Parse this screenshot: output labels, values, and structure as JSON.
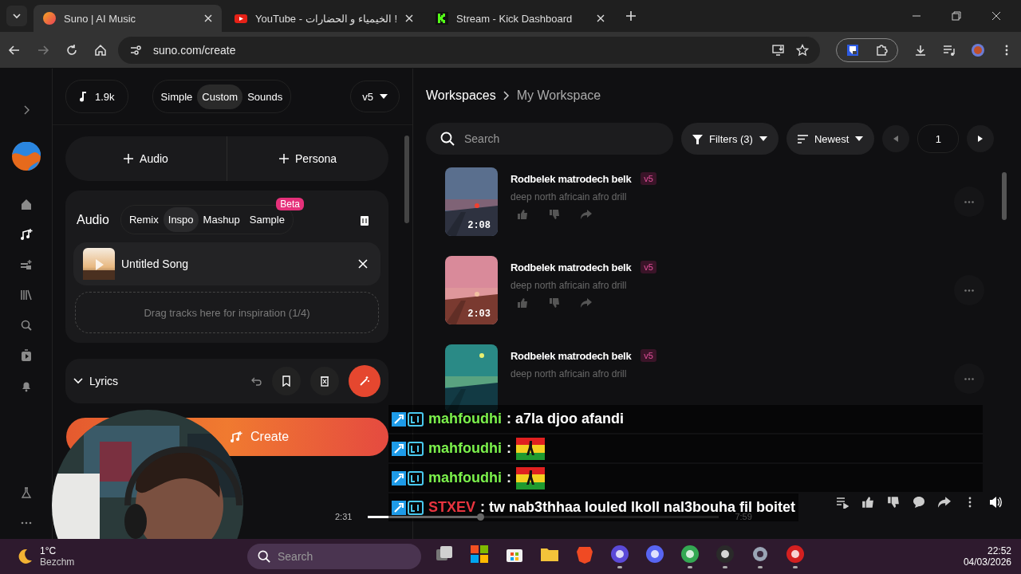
{
  "browser": {
    "tabs": [
      {
        "title": "Suno | AI Music",
        "kind": "suno",
        "selected": true
      },
      {
        "title": "YouTube - الخيمياء و الحضارات !",
        "kind": "youtube",
        "selected": false
      },
      {
        "title": "Stream - Kick Dashboard",
        "kind": "kick",
        "selected": false
      }
    ],
    "address": "suno.com/create"
  },
  "sidebar": {
    "items": [
      {
        "kind": "home",
        "selected": false
      },
      {
        "kind": "create",
        "selected": true
      },
      {
        "kind": "playlist",
        "selected": false
      },
      {
        "kind": "library",
        "selected": false
      },
      {
        "kind": "search",
        "selected": false
      },
      {
        "kind": "video",
        "selected": false
      },
      {
        "kind": "bell",
        "selected": false
      }
    ]
  },
  "top_bar": {
    "credits": "1.9k",
    "modes": [
      {
        "label": "Simple",
        "selected": false
      },
      {
        "label": "Custom",
        "selected": true
      },
      {
        "label": "Sounds",
        "selected": false
      }
    ],
    "model": "v5"
  },
  "add_buttons": [
    "Audio",
    "Persona"
  ],
  "audio_panel": {
    "title": "Audio",
    "tabs": [
      {
        "label": "Remix",
        "selected": false
      },
      {
        "label": "Inspo",
        "selected": true
      },
      {
        "label": "Mashup",
        "selected": false
      },
      {
        "label": "Sample",
        "selected": false
      }
    ],
    "beta_badge": "Beta",
    "song": "Untitled Song",
    "drop_zone": "Drag tracks here for inspiration (1/4)"
  },
  "lyrics": {
    "title": "Lyrics",
    "expanded": true
  },
  "create_button": "Create",
  "workspace": {
    "breadcrumb": [
      "Workspaces",
      "My Workspace"
    ],
    "search_placeholder": "Search",
    "filters": "Filters (3)",
    "sort": "Newest",
    "page": "1",
    "songs": [
      {
        "title": "Rodbelek matrodech belk",
        "version": "v5",
        "description": "deep north africain afro drill",
        "duration": "2:08"
      },
      {
        "title": "Rodbelek matrodech belk",
        "version": "v5",
        "description": "deep north africain afro drill",
        "duration": "2:03"
      },
      {
        "title": "Rodbelek matrodech belk",
        "version": "v5",
        "description": "deep north africain afro drill"
      }
    ]
  },
  "player": {
    "elapsed": "2:31",
    "total": "7:59",
    "level": 0.32
  },
  "chat": [
    {
      "user": "mahfoudhi",
      "color": "#7cf24c",
      "kind": "text",
      "text": ": a7la djoo afandi"
    },
    {
      "user": "mahfoudhi",
      "color": "#7cf24c",
      "kind": "emote",
      "text": ":"
    },
    {
      "user": "mahfoudhi",
      "color": "#7cf24c",
      "kind": "emote",
      "text": ":"
    },
    {
      "user": "STXEV",
      "color": "#e8343f",
      "kind": "text",
      "text": ": tw nab3thhaa louled lkoll nal3bouha fil boitet"
    }
  ],
  "taskbar": {
    "temperature": "1°C",
    "location": "Bezchm",
    "search_placeholder": "Search",
    "apps": [
      {
        "kind": "taskview",
        "open": false
      },
      {
        "kind": "widgets",
        "open": false
      },
      {
        "kind": "store",
        "open": false
      },
      {
        "kind": "folder",
        "open": false
      },
      {
        "kind": "brave",
        "open": false
      },
      {
        "kind": "circle",
        "open": true
      },
      {
        "kind": "discord",
        "open": false
      },
      {
        "kind": "chrome",
        "open": true
      },
      {
        "kind": "obs",
        "open": true
      },
      {
        "kind": "gear",
        "open": true
      },
      {
        "kind": "round",
        "open": true
      }
    ],
    "time": "22:52",
    "date": "04/03/2026"
  }
}
